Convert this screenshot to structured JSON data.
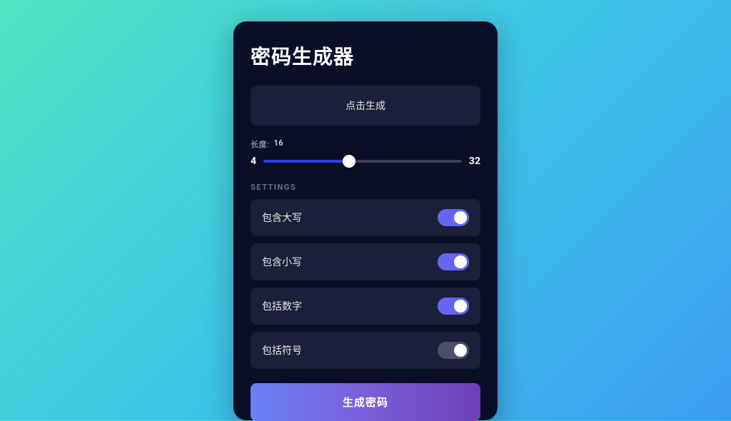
{
  "title": "密码生成器",
  "output": {
    "placeholder": "点击生成"
  },
  "length": {
    "label": "长度:",
    "value": "16",
    "min": "4",
    "max": "32"
  },
  "settings": {
    "header": "SETTINGS",
    "options": [
      {
        "label": "包含大写",
        "enabled": true
      },
      {
        "label": "包含小写",
        "enabled": true
      },
      {
        "label": "包括数字",
        "enabled": true
      },
      {
        "label": "包括符号",
        "enabled": false
      }
    ]
  },
  "generate_button": "生成密码"
}
